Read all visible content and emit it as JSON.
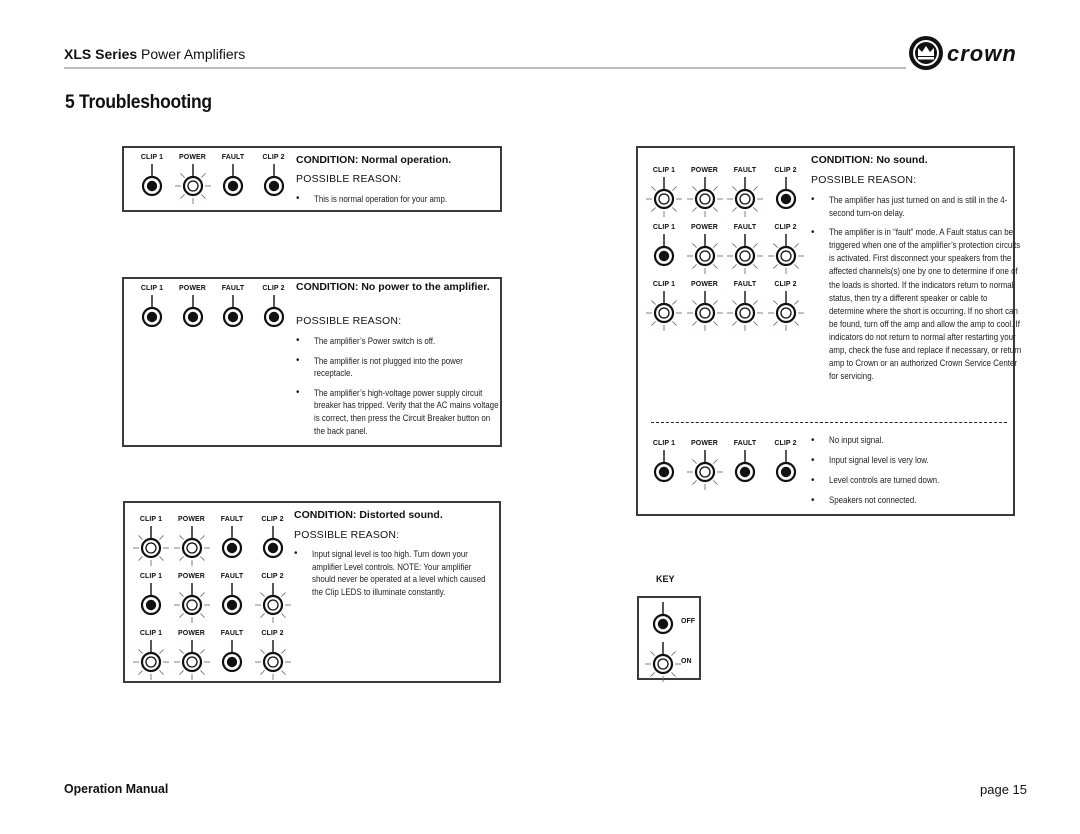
{
  "header": {
    "series_bold": "XLS Series",
    "series_rest": " Power Amplifiers",
    "brand": "crown",
    "logo_icon": "crown-logo-icon"
  },
  "page_title": "5 Troubleshooting",
  "led_labels": [
    "CLIP 1",
    "POWER",
    "FAULT",
    "CLIP 2"
  ],
  "possible_reason_label": "POSSIBLE REASON:",
  "conditions": [
    {
      "title": "CONDITION: Normal operation.",
      "led_rows": [
        [
          "off",
          "on",
          "off",
          "off"
        ]
      ],
      "reasons": [
        "This is normal operation for your amp."
      ]
    },
    {
      "title": "CONDITION: No power to the amplifier.",
      "led_rows": [
        [
          "off",
          "off",
          "off",
          "off"
        ]
      ],
      "reasons": [
        "The amplifier’s Power switch is off.",
        "The amplifier is not plugged into the power receptacle.",
        "The amplifier’s high-voltage power supply circuit breaker has tripped. Verify that the AC mains voltage is correct, then press the Circuit Breaker button on the back panel."
      ]
    },
    {
      "title": "CONDITION: Distorted sound.",
      "led_rows": [
        [
          "on",
          "on",
          "off",
          "off"
        ],
        [
          "off",
          "on",
          "off",
          "on"
        ],
        [
          "on",
          "on",
          "off",
          "on"
        ]
      ],
      "reasons": [
        "Input signal level is too high. Turn down your amplifier Level controls. NOTE: Your amplifier should never be operated at a level which caused the Clip LEDS to illuminate constantly."
      ]
    },
    {
      "title": "CONDITION: No sound.",
      "led_rows": [
        [
          "on",
          "on",
          "on",
          "off"
        ],
        [
          "off",
          "on",
          "on",
          "on"
        ],
        [
          "on",
          "on",
          "on",
          "on"
        ]
      ],
      "reasons": [
        "The amplifier has just turned on and is still in the 4-second turn-on delay.",
        "The amplifier is in “fault” mode. A Fault status can be triggered when one of the amplifier’s protection circuits is activated. First disconnect your speakers from the affected channels(s) one by one to determine if one of the loads is shorted. If the indicators return to normal status, then try a different speaker or cable to determine where the short is occurring. If no short can be found, turn off the amp and allow the amp to cool. If indicators do not return to normal after restarting your amp, check the fuse and replace if necessary, or return amp to Crown or an authorized Crown Service Center for servicing."
      ],
      "sub": {
        "led_rows": [
          [
            "off",
            "on",
            "off",
            "off"
          ]
        ],
        "reasons": [
          "No input signal.",
          "Input signal level is very low.",
          "Level controls are turned down.",
          "Speakers not connected."
        ]
      }
    }
  ],
  "key": {
    "title": "KEY",
    "off_label": "OFF",
    "on_label": "ON"
  },
  "footer": {
    "manual": "Operation Manual",
    "page": "page 15"
  },
  "colors": {
    "box_border": "#3a3a3a",
    "rule": "#bdbdbd",
    "ray": "#8a6a6a"
  }
}
